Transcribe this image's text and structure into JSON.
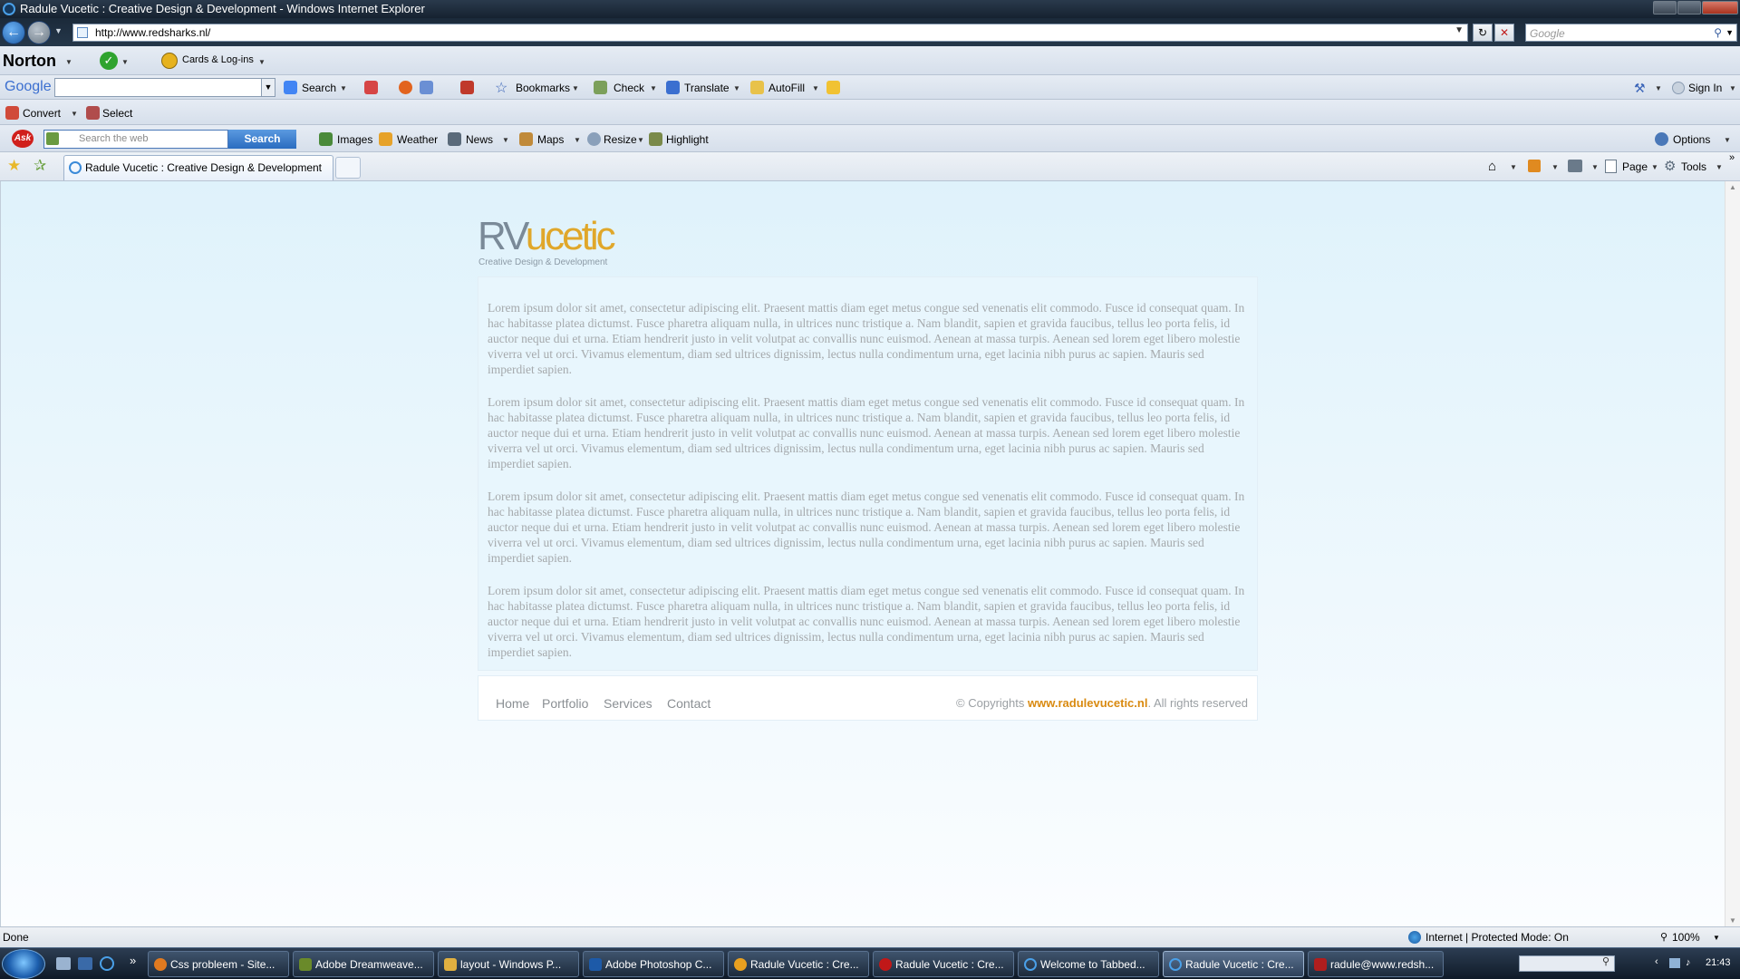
{
  "window": {
    "title": "Radule Vucetic : Creative Design & Development - Windows Internet Explorer"
  },
  "address": {
    "url": "http://www.redsharks.nl/"
  },
  "search_box": {
    "placeholder": "Google"
  },
  "norton": {
    "brand": "Norton",
    "cards_label": "Cards & Log-ins"
  },
  "google_toolbar": {
    "brand": "Google",
    "search_label": "Search",
    "bookmarks_label": "Bookmarks",
    "check_label": "Check",
    "translate_label": "Translate",
    "autofill_label": "AutoFill",
    "signin_label": "Sign In"
  },
  "convert_toolbar": {
    "convert_label": "Convert",
    "select_label": "Select"
  },
  "ask_toolbar": {
    "brand": "Ask",
    "search_placeholder": "Search the web",
    "search_button": "Search",
    "images_label": "Images",
    "weather_label": "Weather",
    "news_label": "News",
    "maps_label": "Maps",
    "resize_label": "Resize",
    "highlight_label": "Highlight",
    "options_label": "Options"
  },
  "tabs": {
    "active_tab": "Radule Vucetic : Creative Design & Development",
    "page_label": "Page",
    "tools_label": "Tools"
  },
  "site": {
    "logo_rv": "RV",
    "logo_ucetic": "ucetic",
    "tagline": "Creative Design & Development",
    "paragraphs": [
      "Lorem ipsum dolor sit amet, consectetur adipiscing elit. Praesent mattis diam eget metus congue sed venenatis elit commodo. Fusce id consequat quam. In hac habitasse platea dictumst. Fusce pharetra aliquam nulla, in ultrices nunc tristique a. Nam blandit, sapien et gravida faucibus, tellus leo porta felis, id auctor neque dui et urna. Etiam hendrerit justo in velit volutpat ac convallis nunc euismod. Aenean at massa turpis. Aenean sed lorem eget libero molestie viverra vel ut orci. Vivamus elementum, diam sed ultrices dignissim, lectus nulla condimentum urna, eget lacinia nibh purus ac sapien. Mauris sed imperdiet sapien.",
      "Lorem ipsum dolor sit amet, consectetur adipiscing elit. Praesent mattis diam eget metus congue sed venenatis elit commodo. Fusce id consequat quam. In hac habitasse platea dictumst. Fusce pharetra aliquam nulla, in ultrices nunc tristique a. Nam blandit, sapien et gravida faucibus, tellus leo porta felis, id auctor neque dui et urna. Etiam hendrerit justo in velit volutpat ac convallis nunc euismod. Aenean at massa turpis. Aenean sed lorem eget libero molestie viverra vel ut orci. Vivamus elementum, diam sed ultrices dignissim, lectus nulla condimentum urna, eget lacinia nibh purus ac sapien. Mauris sed imperdiet sapien.",
      "Lorem ipsum dolor sit amet, consectetur adipiscing elit. Praesent mattis diam eget metus congue sed venenatis elit commodo. Fusce id consequat quam. In hac habitasse platea dictumst. Fusce pharetra aliquam nulla, in ultrices nunc tristique a. Nam blandit, sapien et gravida faucibus, tellus leo porta felis, id auctor neque dui et urna. Etiam hendrerit justo in velit volutpat ac convallis nunc euismod. Aenean at massa turpis. Aenean sed lorem eget libero molestie viverra vel ut orci. Vivamus elementum, diam sed ultrices dignissim, lectus nulla condimentum urna, eget lacinia nibh purus ac sapien. Mauris sed imperdiet sapien.",
      "Lorem ipsum dolor sit amet, consectetur adipiscing elit. Praesent mattis diam eget metus congue sed venenatis elit commodo. Fusce id consequat quam. In hac habitasse platea dictumst. Fusce pharetra aliquam nulla, in ultrices nunc tristique a. Nam blandit, sapien et gravida faucibus, tellus leo porta felis, id auctor neque dui et urna. Etiam hendrerit justo in velit volutpat ac convallis nunc euismod. Aenean at massa turpis. Aenean sed lorem eget libero molestie viverra vel ut orci. Vivamus elementum, diam sed ultrices dignissim, lectus nulla condimentum urna, eget lacinia nibh purus ac sapien. Mauris sed imperdiet sapien."
    ],
    "nav": [
      "Home",
      "Portfolio",
      "Services",
      "Contact"
    ],
    "copyright_prefix": "© Copyrights",
    "copyright_link": "www.radulevucetic.nl",
    "copyright_suffix": ". All rights reserved",
    "colors": {
      "accent": "#e0a72a",
      "link": "#d98a10",
      "panel": "#e8f6fd"
    }
  },
  "status": {
    "left": "Done",
    "zone": "Internet | Protected Mode: On",
    "zoom": "100%"
  },
  "taskbar": {
    "tasks": [
      "Css probleem - Site...",
      "Adobe Dreamweave...",
      "layout - Windows P...",
      "Adobe Photoshop C...",
      "Radule Vucetic : Cre...",
      "Radule Vucetic : Cre...",
      "Welcome to Tabbed...",
      "Radule Vucetic : Cre...",
      "radule@www.redsh..."
    ],
    "clock": "21:43"
  }
}
